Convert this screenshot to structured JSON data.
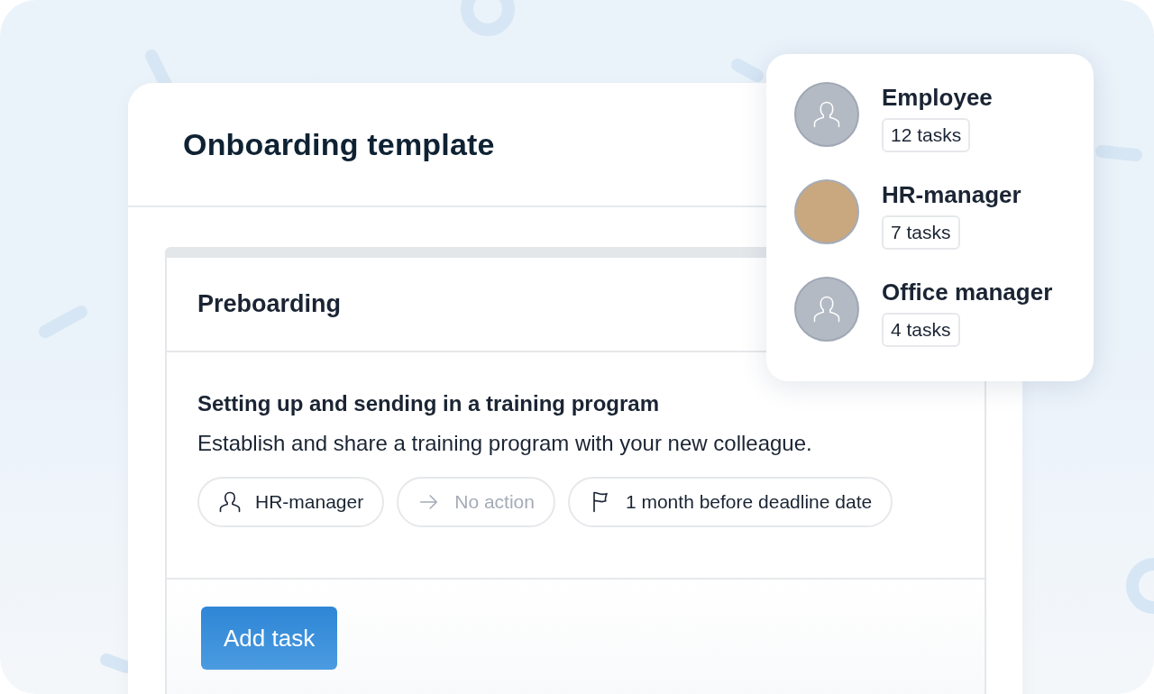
{
  "template": {
    "title": "Onboarding template"
  },
  "section": {
    "title": "Preboarding",
    "task": {
      "title": "Setting up and sending in a training program",
      "description": "Establish and share a training program with your new colleague.",
      "chips": [
        {
          "kind": "assignee",
          "label": "HR-manager",
          "disabled": false
        },
        {
          "kind": "action",
          "label": "No action",
          "disabled": true
        },
        {
          "kind": "deadline",
          "label": "1 month before deadline date",
          "disabled": false
        }
      ]
    }
  },
  "add_button": "Add task",
  "roles": [
    {
      "name": "Employee",
      "count": "12 tasks",
      "kind": "placeholder"
    },
    {
      "name": "HR-manager",
      "count": "7 tasks",
      "kind": "photo"
    },
    {
      "name": "Office manager",
      "count": "4 tasks",
      "kind": "placeholder"
    }
  ]
}
